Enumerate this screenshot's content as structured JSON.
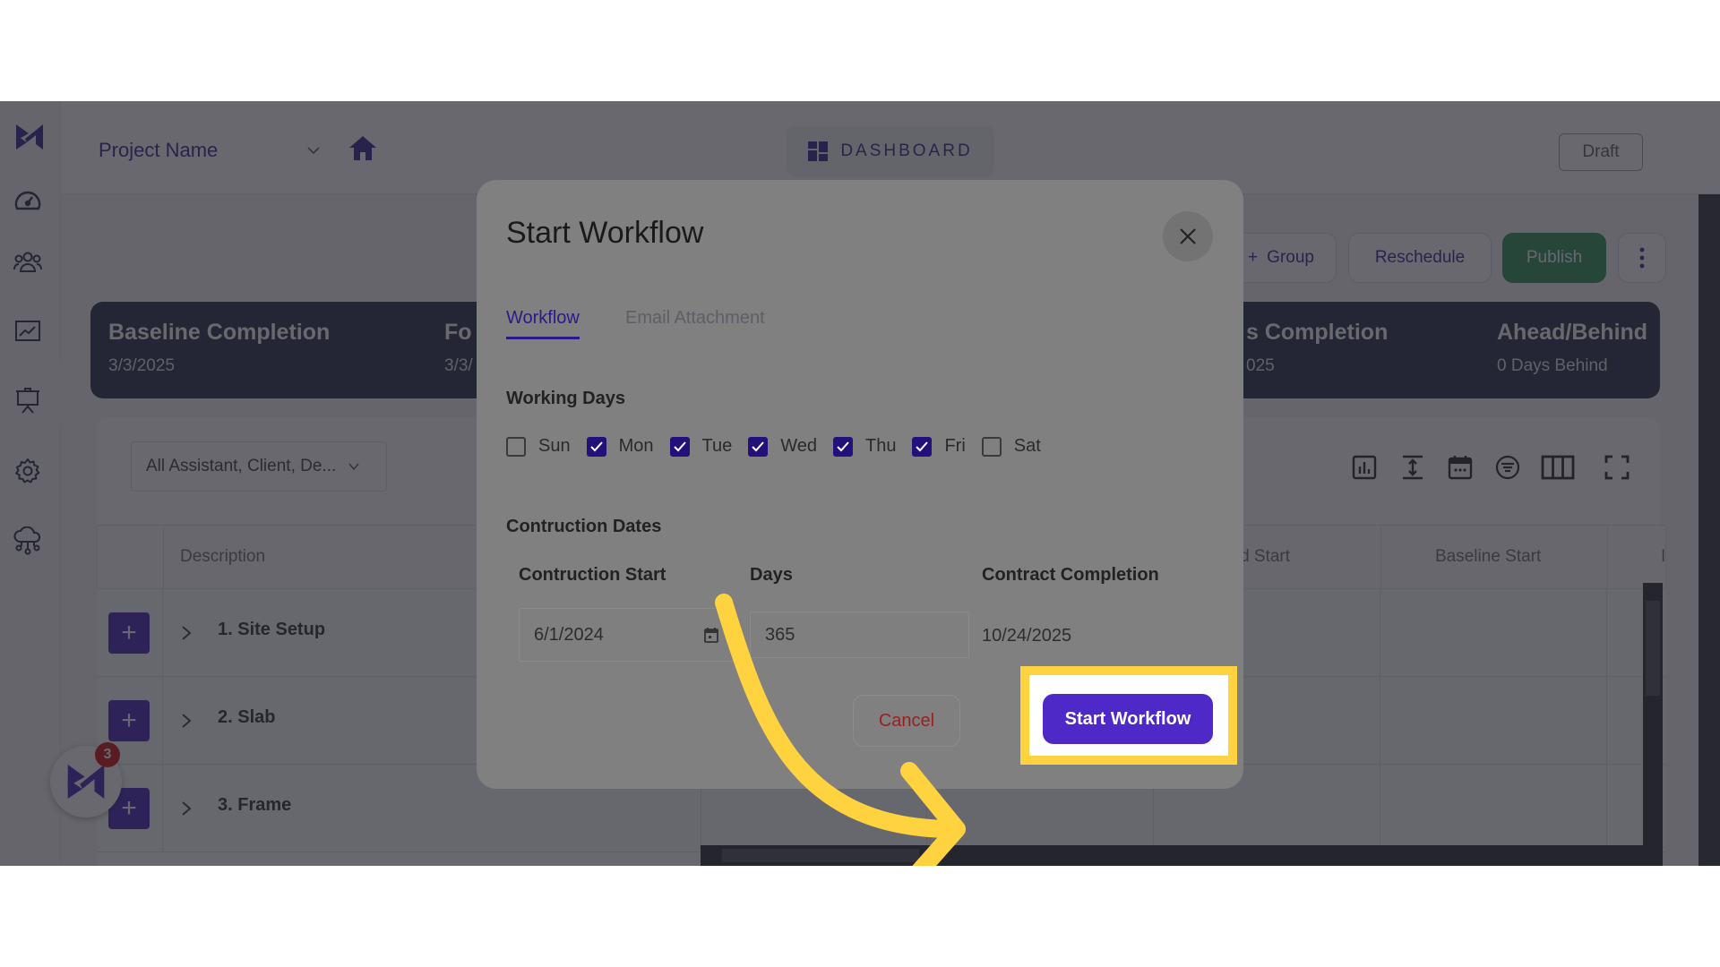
{
  "app": {
    "project_name": "Project Name",
    "dashboard_label": "DASHBOARD",
    "status_label": "Draft"
  },
  "sidebar": {
    "items": [
      {
        "icon": "speedometer-icon"
      },
      {
        "icon": "team-icon"
      },
      {
        "icon": "chart-icon"
      },
      {
        "icon": "presentation-icon"
      },
      {
        "icon": "gear-icon"
      },
      {
        "icon": "cloud-network-icon"
      }
    ]
  },
  "actions": {
    "group_label": "Group",
    "reschedule_label": "Reschedule",
    "publish_label": "Publish"
  },
  "summary": [
    {
      "title": "Baseline Completion",
      "value": "3/3/2025"
    },
    {
      "title": "Fo",
      "value": "3/3/"
    },
    {
      "title": "s Completion",
      "value": "025"
    },
    {
      "title": "Ahead/Behind",
      "value": "0 Days Behind"
    }
  ],
  "grid": {
    "filter_value": "All Assistant, Client, De...",
    "toolbar_icons": [
      "bar-chart-icon",
      "expand-vertical-icon",
      "calendar-icon",
      "filter-icon",
      "columns-icon",
      "fullscreen-icon"
    ],
    "columns": [
      "Description",
      "ked Start",
      "Baseline Start",
      "I"
    ],
    "rows": [
      {
        "title": "1. Site Setup"
      },
      {
        "title": "2. Slab"
      },
      {
        "title": "3. Frame"
      }
    ]
  },
  "fab": {
    "badge_count": "3"
  },
  "modal": {
    "title": "Start Workflow",
    "tabs": [
      {
        "label": "Workflow",
        "active": true
      },
      {
        "label": "Email Attachment",
        "active": false
      }
    ],
    "working_days_label": "Working Days",
    "days": [
      {
        "label": "Sun",
        "checked": false
      },
      {
        "label": "Mon",
        "checked": true
      },
      {
        "label": "Tue",
        "checked": true
      },
      {
        "label": "Wed",
        "checked": true
      },
      {
        "label": "Thu",
        "checked": true
      },
      {
        "label": "Fri",
        "checked": true
      },
      {
        "label": "Sat",
        "checked": false
      }
    ],
    "dates_label": "Contruction Dates",
    "construction_start_label": "Contruction Start",
    "construction_start_value": "6/1/2024",
    "days_label": "Days",
    "days_value": "365",
    "contract_completion_label": "Contract Completion",
    "contract_completion_value": "10/24/2025",
    "cancel_label": "Cancel",
    "start_label": "Start Workflow"
  },
  "colors": {
    "brand": "#2a1a8a",
    "primary_button": "#4f28c8",
    "publish": "#1e8d4e",
    "highlight": "#ffd23f",
    "badge": "#c80000"
  }
}
